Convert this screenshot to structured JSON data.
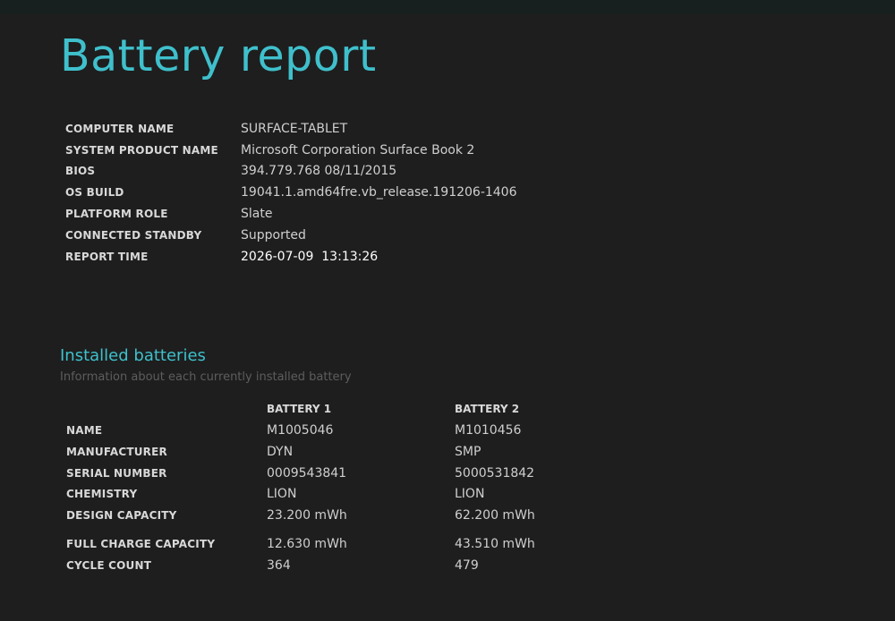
{
  "page_title": "Battery report",
  "system_info": [
    {
      "label": "COMPUTER NAME",
      "value": "SURFACE-TABLET"
    },
    {
      "label": "SYSTEM PRODUCT NAME",
      "value": "Microsoft Corporation Surface Book 2"
    },
    {
      "label": "BIOS",
      "value": "394.779.768 08/11/2015"
    },
    {
      "label": "OS BUILD",
      "value": "19041.1.amd64fre.vb_release.191206-1406"
    },
    {
      "label": "PLATFORM ROLE",
      "value": "Slate"
    },
    {
      "label": "CONNECTED STANDBY",
      "value": "Supported"
    },
    {
      "label": "REPORT TIME",
      "value": "2026-07-09  13:13:26"
    }
  ],
  "installed_batteries": {
    "title": "Installed batteries",
    "subtitle": "Information about each currently installed battery",
    "headers": [
      "BATTERY 1",
      "BATTERY 2"
    ],
    "rows": [
      {
        "label": "NAME",
        "b1": "M1005046",
        "b2": "M1010456"
      },
      {
        "label": "MANUFACTURER",
        "b1": "DYN",
        "b2": "SMP"
      },
      {
        "label": "SERIAL NUMBER",
        "b1": "0009543841",
        "b2": "5000531842"
      },
      {
        "label": "CHEMISTRY",
        "b1": "LION",
        "b2": "LION"
      },
      {
        "label": "DESIGN CAPACITY",
        "b1": "23.200 mWh",
        "b2": "62.200 mWh"
      },
      {
        "label": "FULL CHARGE CAPACITY",
        "b1": "12.630 mWh",
        "b2": "43.510 mWh"
      },
      {
        "label": "CYCLE COUNT",
        "b1": "364",
        "b2": "479"
      }
    ]
  },
  "colors": {
    "background": "#1e1e1e",
    "accent": "#3fc0cc",
    "label": "#d8d8d8",
    "value": "#cfcfcf",
    "muted": "#5d5d5d"
  }
}
